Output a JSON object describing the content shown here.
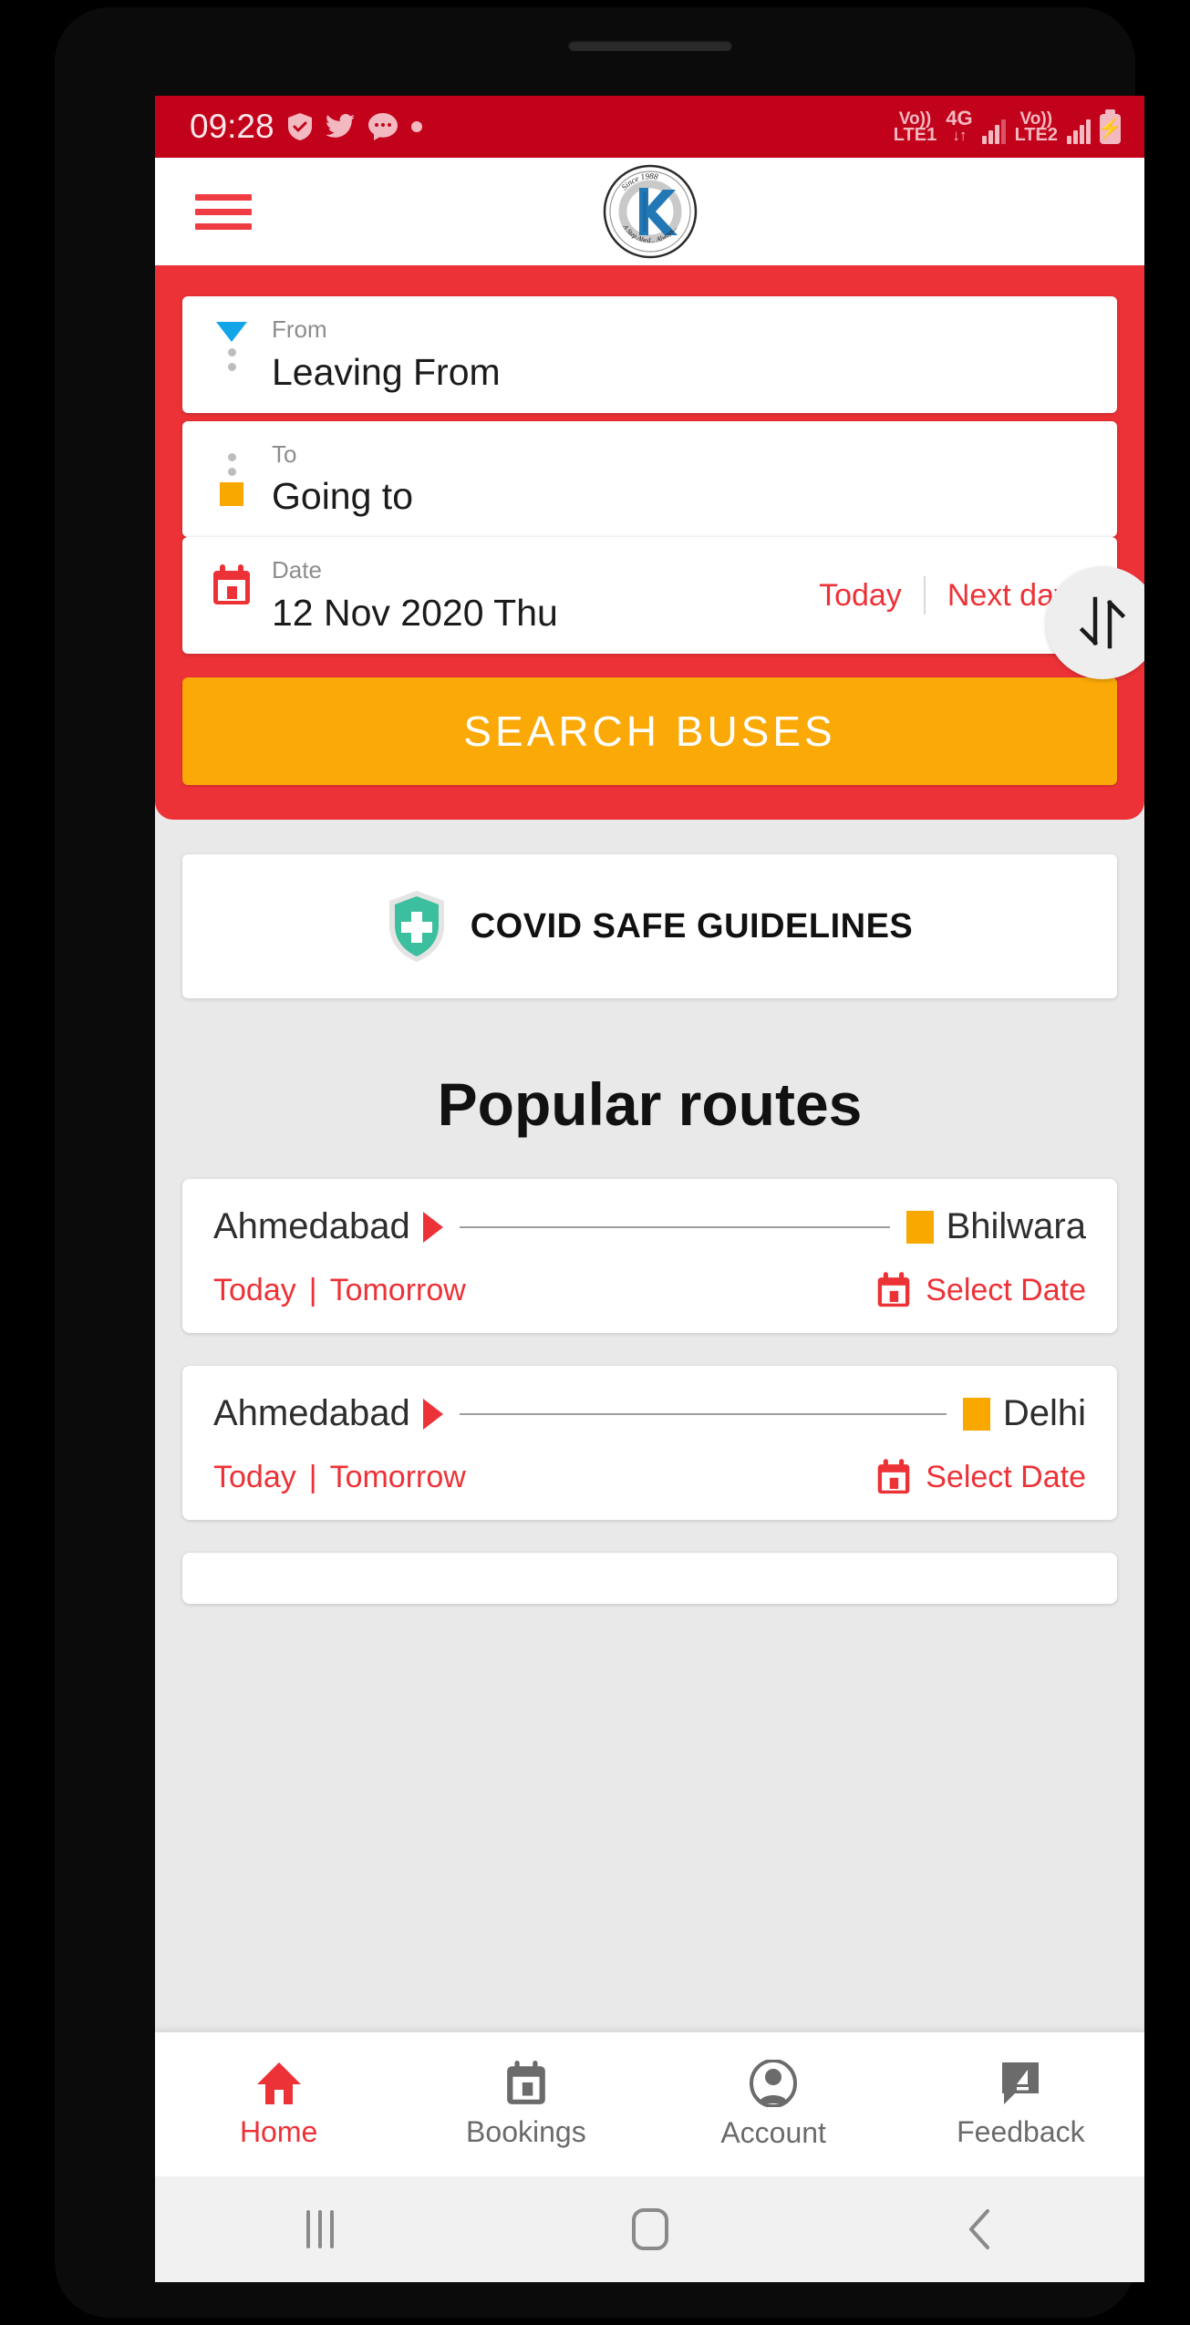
{
  "status_bar": {
    "clock": "09:28",
    "left_icons": [
      "shield-check-icon",
      "twitter-icon",
      "chat-bubble-icon",
      "dot-icon"
    ],
    "volte1_line1": "Vo))",
    "volte1_line2": "LTE1",
    "network_type": "4G",
    "data_arrows": "↓↑",
    "volte2_line1": "Vo))",
    "volte2_line2": "LTE2",
    "battery_glyph": "⚡"
  },
  "header": {
    "menu_icon": "hamburger-icon",
    "logo": {
      "top_text": "Since 1988",
      "letter": "K",
      "bottom_text": "A Step Ahed... Always..."
    }
  },
  "search_panel": {
    "from": {
      "label": "From",
      "value": "Leaving From",
      "marker": "blue-triangle-down-icon"
    },
    "to": {
      "label": "To",
      "value": "Going to",
      "marker": "orange-square-icon"
    },
    "swap_icon": "swap-arrows-icon",
    "date": {
      "label": "Date",
      "value": "12 Nov 2020 Thu",
      "icon": "calendar-icon",
      "today_label": "Today",
      "next_day_label": "Next day"
    },
    "search_button_label": "SEARCH BUSES"
  },
  "covid_banner": {
    "icon": "shield-cross-icon",
    "label": "COVID SAFE GUIDELINES"
  },
  "popular_routes": {
    "title": "Popular routes",
    "routes": [
      {
        "from": "Ahmedabad",
        "to": "Bhilwara",
        "today_label": "Today",
        "separator": "|",
        "tomorrow_label": "Tomorrow",
        "select_date_label": "Select Date"
      },
      {
        "from": "Ahmedabad",
        "to": "Delhi",
        "today_label": "Today",
        "separator": "|",
        "tomorrow_label": "Tomorrow",
        "select_date_label": "Select Date"
      }
    ]
  },
  "bottom_nav": {
    "items": [
      {
        "label": "Home",
        "icon": "home-icon",
        "active": true
      },
      {
        "label": "Bookings",
        "icon": "bookings-calendar-icon",
        "active": false
      },
      {
        "label": "Account",
        "icon": "account-person-icon",
        "active": false
      },
      {
        "label": "Feedback",
        "icon": "feedback-speech-icon",
        "active": false
      }
    ]
  },
  "android_nav": {
    "recents": "recents-icon",
    "home": "home-square-icon",
    "back": "back-chevron-icon"
  },
  "colors": {
    "brand_red": "#ed3237",
    "status_bar_red": "#c2021a",
    "accent_orange": "#faa907",
    "marker_blue": "#12a6e8",
    "marker_orange": "#f9a800",
    "covid_teal": "#3cbf9e"
  }
}
